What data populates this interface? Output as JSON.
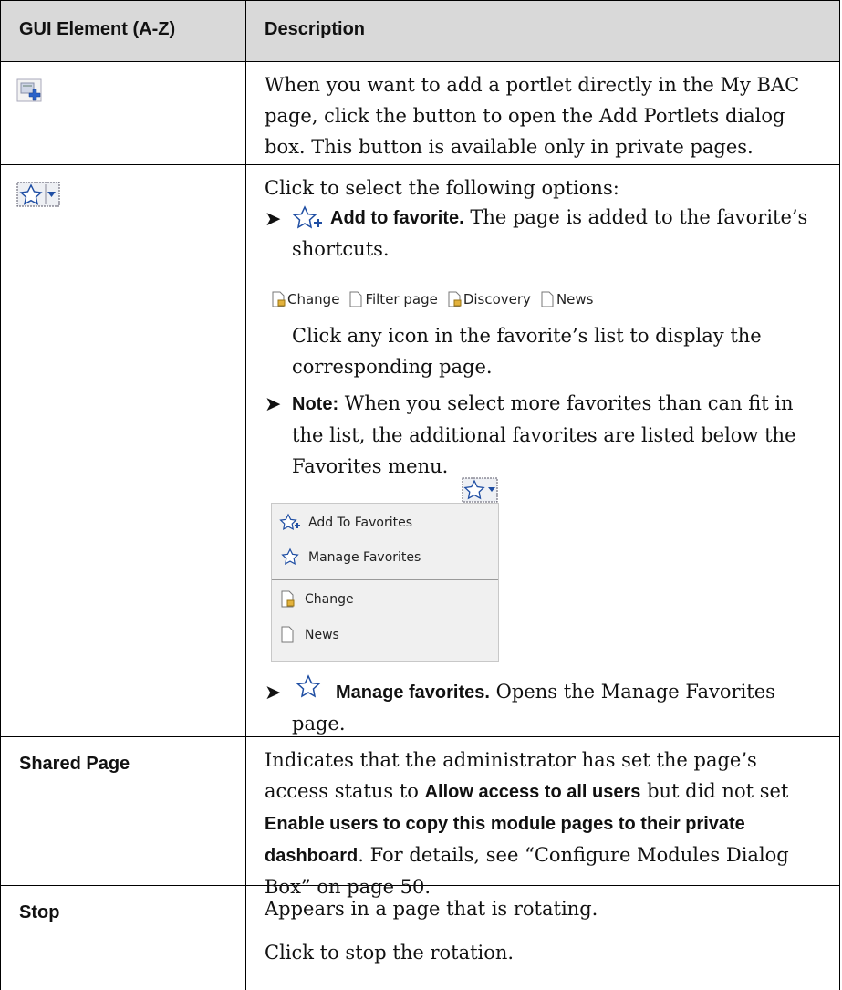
{
  "header": {
    "col1": "GUI Element (A-Z)",
    "col2": "Description"
  },
  "row1": {
    "description": "When you want to add a portlet directly in the My BAC page, click the button to open the Add Portlets dialog box. This button is available only in private pages."
  },
  "row2": {
    "intro": "Click to select the following options:",
    "bullet1_title": "Add to favorite.",
    "bullet1_text": "The page is added to the favorite’s shortcuts.",
    "favorites_bar": [
      "Change",
      "Filter page",
      "Discovery",
      "News"
    ],
    "click_text": "Click any icon in the favorite’s list to display the corresponding page.",
    "note_title": "Note:",
    "note_text": "When you select more favorites than can fit in the list, the additional favorites are listed below the Favorites menu.",
    "menu": {
      "add": "Add To Favorites",
      "manage": "Manage Favorites",
      "change": "Change",
      "news": "News"
    },
    "bullet3_title": "Manage favorites.",
    "bullet3_text": "Opens the Manage Favorites page."
  },
  "row3": {
    "element": "Shared Page",
    "t1": "Indicates that the administrator has set the page’s access status to ",
    "b1": "Allow access to all users",
    "t2": " but did not set ",
    "b2": "Enable users to copy this module pages to their private dashboard",
    "t3": ". For details, see “Configure Modules Dialog Box” on page 50."
  },
  "row4": {
    "element": "Stop",
    "line1": "Appears in a page that is rotating.",
    "line2": "Click to stop the rotation."
  }
}
